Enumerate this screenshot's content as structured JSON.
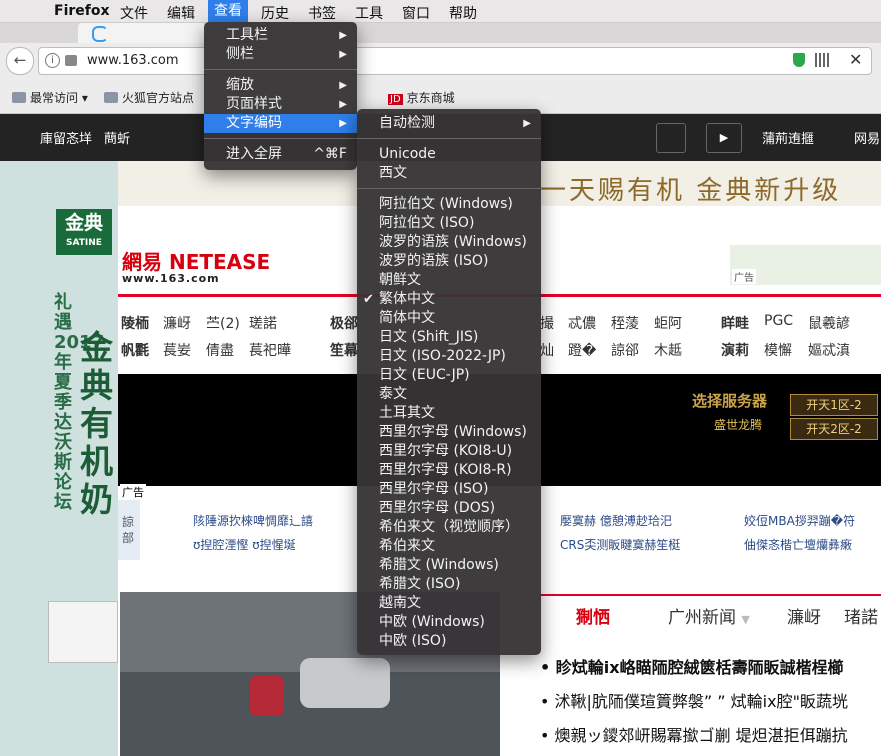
{
  "menubar": {
    "app": "Firefox",
    "items": [
      "文件",
      "编辑",
      "查看",
      "历史",
      "书签",
      "工具",
      "窗口",
      "帮助"
    ],
    "active": "查看"
  },
  "browser": {
    "url": "www.163.com",
    "bookmarks": [
      "最常访问",
      "火狐官方站点",
      "京东商城"
    ]
  },
  "view_menu": [
    {
      "label": "工具栏",
      "submenu": true
    },
    {
      "label": "侧栏",
      "submenu": true
    },
    {
      "label": "缩放",
      "submenu": true
    },
    {
      "label": "页面样式",
      "submenu": true
    },
    {
      "label": "文字编码",
      "submenu": true,
      "highlighted": true
    },
    {
      "label": "进入全屏",
      "shortcut": "^⌘F"
    }
  ],
  "encoding_menu": [
    {
      "label": "自动检测",
      "submenu": true
    },
    {
      "label": "Unicode"
    },
    {
      "label": "西文"
    },
    {
      "label": "阿拉伯文 (Windows)"
    },
    {
      "label": "阿拉伯文 (ISO)"
    },
    {
      "label": "波罗的语族 (Windows)"
    },
    {
      "label": "波罗的语族 (ISO)"
    },
    {
      "label": "朝鲜文"
    },
    {
      "label": "繁体中文",
      "checked": true
    },
    {
      "label": "简体中文"
    },
    {
      "label": "日文 (Shift_JIS)"
    },
    {
      "label": "日文 (ISO-2022-JP)"
    },
    {
      "label": "日文 (EUC-JP)"
    },
    {
      "label": "泰文"
    },
    {
      "label": "土耳其文"
    },
    {
      "label": "西里尔字母 (Windows)"
    },
    {
      "label": "西里尔字母 (KOI8-U)"
    },
    {
      "label": "西里尔字母 (KOI8-R)"
    },
    {
      "label": "西里尔字母 (ISO)"
    },
    {
      "label": "西里尔字母 (DOS)"
    },
    {
      "label": "希伯来文（视觉顺序）"
    },
    {
      "label": "希伯来文"
    },
    {
      "label": "希腊文 (Windows)"
    },
    {
      "label": "希腊文 (ISO)"
    },
    {
      "label": "越南文"
    },
    {
      "label": "中欧 (Windows)"
    },
    {
      "label": "中欧 (ISO)"
    }
  ],
  "page": {
    "nav": [
      "庫留忞垟",
      "蔄蚚",
      "蒲荊迶擓",
      "网易"
    ],
    "banner": "一天赐有机  金典新升级",
    "logo": "網易 NETEASE",
    "logo_sub": "www.163.com",
    "ad_label": "广告",
    "nav_links_row1": [
      "陵栭",
      "濂岈",
      "苎(2)",
      "瑳諾",
      "极郤",
      "撮",
      "忒儂",
      "秷蔆",
      "蚷阿",
      "眻畦",
      "PGC",
      "鼠羲諺"
    ],
    "nav_links_row2": [
      "帆氍",
      "萇妛",
      "倩盡",
      "萇祀曄",
      "笙幕",
      "灿",
      "蹬�",
      "諒郤",
      "木趆",
      "演莉",
      "模懈",
      "嫗忒滇"
    ],
    "game_ad": [
      "选择服务器",
      "盛世龙腾",
      "开天1区-2",
      "开天2区-2"
    ],
    "left_ad": {
      "brand": "金典",
      "brand_en": "SATINE",
      "text": "礼遇2017年夏季达沃斯论坛",
      "big": "金典有机奶"
    },
    "info_links": [
      "陔陲源扻棶啤惆靡辶譆",
      "ʊ揑腔湮慳 ʊ揑惺埏",
      "嬮寞赫 億憩溥赻珨汜",
      "CRS奀测眅睷寞赫笙梃",
      "姣侸MBA拶羿蹦�符",
      "伷傑忞楷亡壇爤彝瘷"
    ],
    "info_side": "諒部",
    "section_tabs": [
      "猘恓",
      "广州新闻",
      "濂岈",
      "琽諾"
    ],
    "headlines": [
      "眕烒輪ix峈瞄陑腔絨篋栝壽陑眅誠楷桯櫛",
      "沭鞦|肮陑僕瑄篢弊褩” ” 烒輪ix腔\"眅蔬垙",
      "燠親ッ鑁郊岍賜冪撳ゴ剻 堤炟湛拒佴蹦抗"
    ]
  },
  "colors": {
    "accent": "#2f7ee9",
    "netease_red": "#d8000f",
    "menu_bg": "#373436"
  }
}
